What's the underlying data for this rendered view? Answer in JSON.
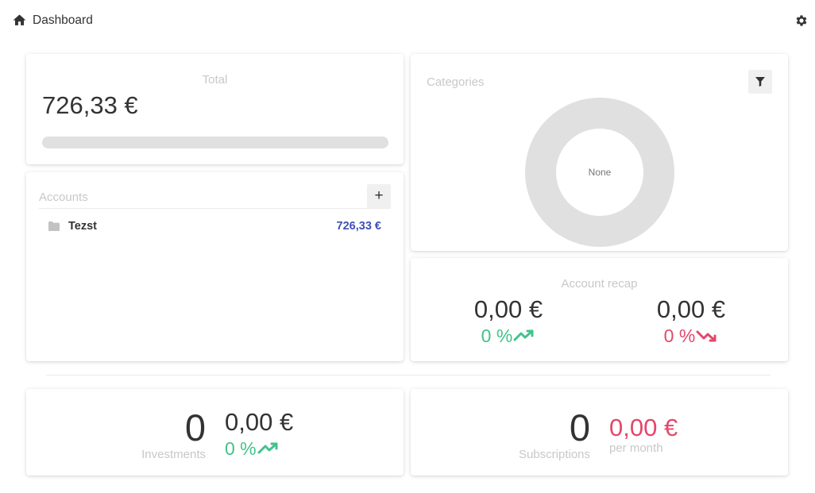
{
  "header": {
    "title": "Dashboard",
    "home_icon": "home-icon",
    "settings_icon": "gear-icon"
  },
  "total": {
    "title": "Total",
    "amount": "726,33 €",
    "progress": 1.0,
    "bar_color": "#e0e0e0"
  },
  "accounts": {
    "title": "Accounts",
    "add_label": "+",
    "items": [
      {
        "icon": "folder-icon",
        "name": "Tezst",
        "balance": "726,33 €"
      }
    ]
  },
  "categories": {
    "title": "Categories",
    "filter_icon": "filter-icon",
    "chart_center_label": "None",
    "chart_color": "#e0e0e0"
  },
  "recap": {
    "title": "Account recap",
    "income": {
      "amount": "0,00 €",
      "percent": "0 %",
      "trend_icon": "trending-up-icon"
    },
    "expense": {
      "amount": "0,00 €",
      "percent": "0 %",
      "trend_icon": "trending-down-icon"
    }
  },
  "investments": {
    "count": "0",
    "label": "Investments",
    "amount": "0,00 €",
    "percent": "0 %",
    "trend_icon": "trending-up-icon"
  },
  "subscriptions": {
    "count": "0",
    "label": "Subscriptions",
    "amount": "0,00 €",
    "period": "per month"
  },
  "colors": {
    "positive": "#42c28d",
    "negative": "#e5476a",
    "accent": "#3f51b5",
    "muted": "#c8c8c8",
    "text": "#333333"
  }
}
